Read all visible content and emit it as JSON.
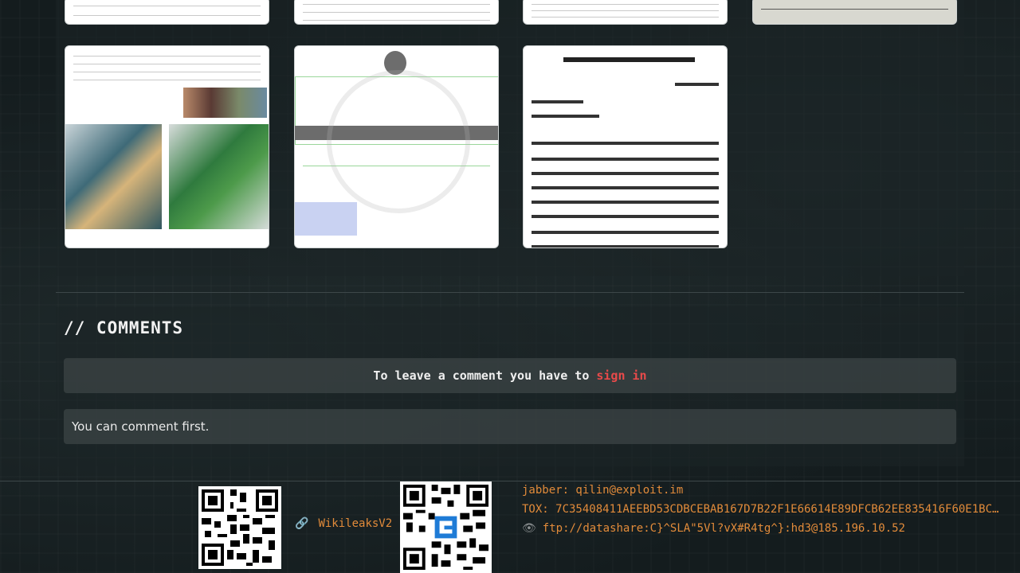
{
  "comments": {
    "title": "// COMMENTS",
    "signin_prefix": "To leave a comment you have to",
    "signin_link": "sign in",
    "empty_text": "You can comment first."
  },
  "footer": {
    "wiki_label": "WikileaksV2",
    "jabber": "jabber: qilin@exploit.im",
    "tox": "TOX: 7C35408411AEEBD53CDBCEBAB167D7B22F1E66614E89DFCB62EE835416F60E1BC…",
    "ftp": "ftp://datashare:C}^SLA\"5Vl?vX#R4tg^}:hd3@185.196.10.52"
  },
  "icons": {
    "link": "link-icon",
    "eye": "eye-icon"
  },
  "colors": {
    "accent": "#e28b3a",
    "signin": "#e84a4a"
  }
}
